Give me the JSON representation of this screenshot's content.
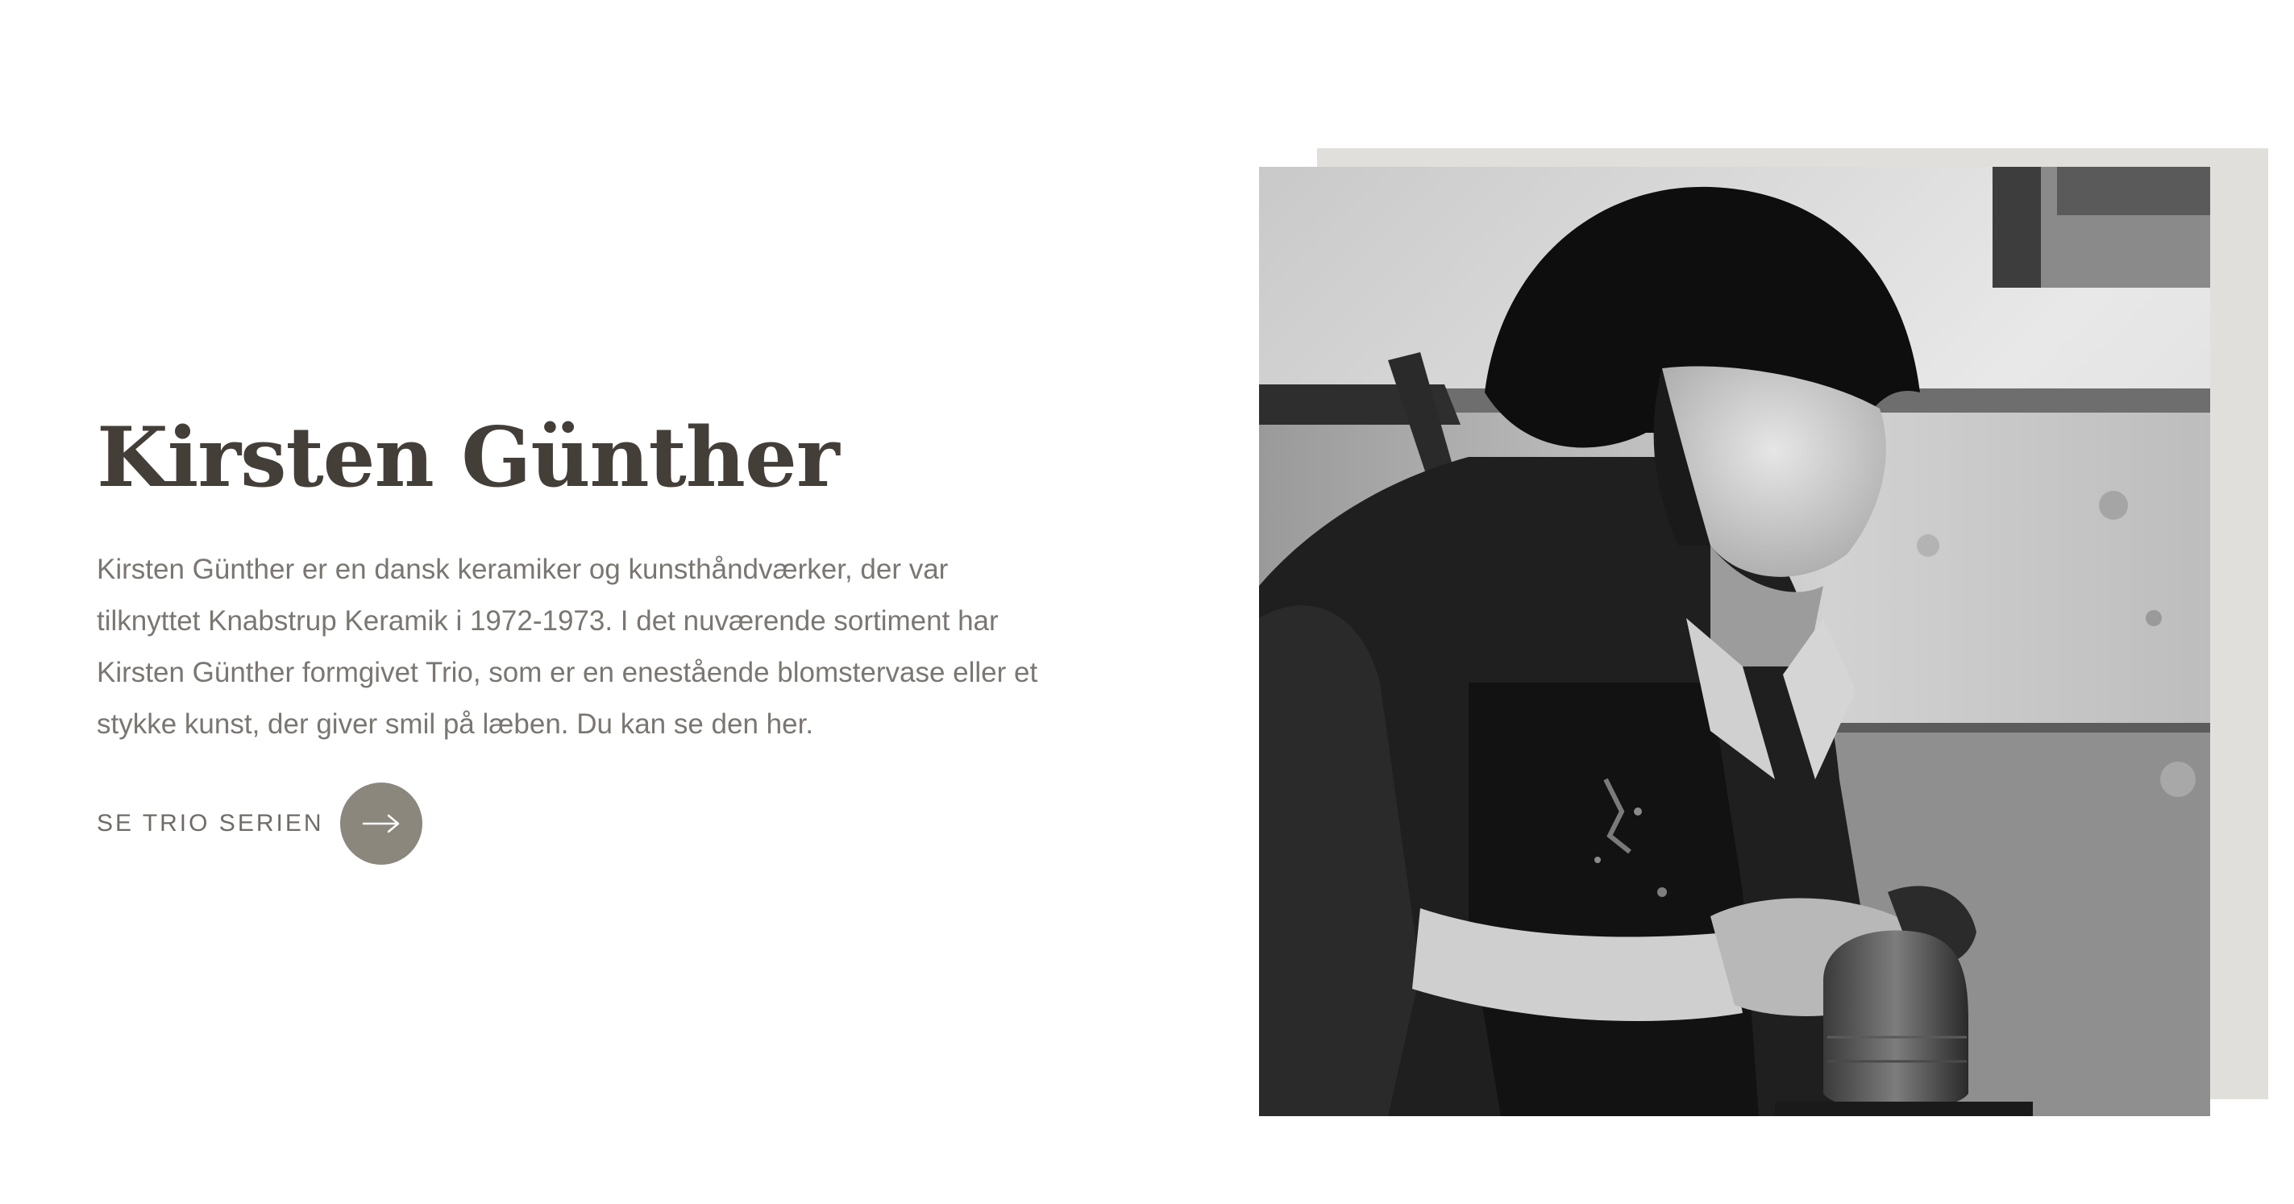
{
  "feature": {
    "title": "Kirsten Günther",
    "description": "Kirsten Günther er en dansk keramiker og kunsthåndværker, der var tilknyttet Knabstrup Keramik i 1972-1973. I det nuværende sortiment har Kirsten Günther formgivet Trio, som er en enestående blomstervase eller et stykke kunst, der giver smil på læben. Du kan se den her.",
    "cta_label": "SE TRIO SERIEN",
    "cta_icon": "arrow-right-icon"
  },
  "photo": {
    "subject": "black-and-white photo of a ceramicist shaping a clay vase at a potter's wheel",
    "style": "monochrome"
  },
  "colors": {
    "title": "#443e39",
    "body_text": "#7a7672",
    "cta_circle": "#8b877d",
    "photo_backdrop": "#e0dfdb"
  }
}
